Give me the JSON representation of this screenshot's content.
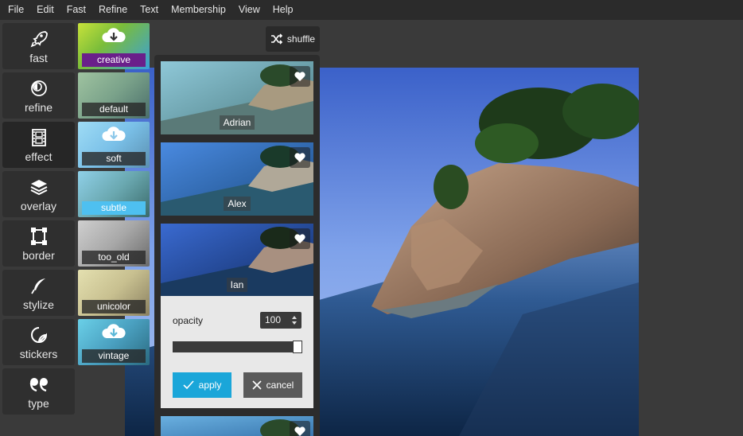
{
  "menu": [
    "File",
    "Edit",
    "Fast",
    "Refine",
    "Text",
    "Membership",
    "View",
    "Help"
  ],
  "tools": [
    {
      "label": "fast",
      "icon": "rocket-icon"
    },
    {
      "label": "refine",
      "icon": "refine-icon"
    },
    {
      "label": "effect",
      "icon": "film-icon",
      "active": true
    },
    {
      "label": "overlay",
      "icon": "layers-icon"
    },
    {
      "label": "border",
      "icon": "border-icon"
    },
    {
      "label": "stylize",
      "icon": "feather-icon"
    },
    {
      "label": "stickers",
      "icon": "sticker-icon"
    },
    {
      "label": "type",
      "icon": "quote-icon"
    }
  ],
  "effect_categories": [
    {
      "label": "creative",
      "icon": "cloud-download-icon",
      "style": "purple"
    },
    {
      "label": "default"
    },
    {
      "label": "soft",
      "icon": "cloud-download-icon"
    },
    {
      "label": "subtle",
      "style": "selected"
    },
    {
      "label": "too_old"
    },
    {
      "label": "unicolor"
    },
    {
      "label": "vintage",
      "icon": "cloud-download-icon"
    }
  ],
  "toolbar": {
    "shuffle_label": "shuffle",
    "shuffle_icon": "shuffle-icon"
  },
  "effects": [
    {
      "name": "Adrian",
      "icon": "heart-icon"
    },
    {
      "name": "Alex",
      "icon": "heart-icon"
    },
    {
      "name": "Ian",
      "icon": "heart-icon"
    },
    {
      "name": "",
      "icon": "heart-icon"
    }
  ],
  "options": {
    "opacity_label": "opacity",
    "opacity_value": "100",
    "opacity_level": 1.0,
    "apply_label": "apply",
    "cancel_label": "cancel"
  },
  "colors": {
    "accent": "#1aa6d9",
    "selected": "#4ec0f0",
    "panel": "#2c2c2c",
    "menubar": "#2b2b2b"
  }
}
